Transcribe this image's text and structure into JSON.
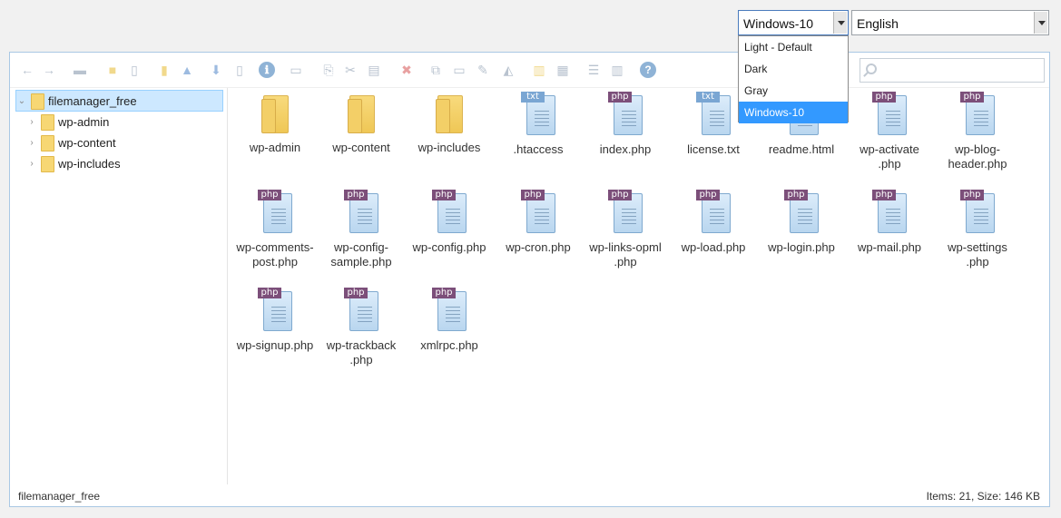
{
  "theme_select": {
    "value": "Windows-10",
    "options": [
      "Light - Default",
      "Dark",
      "Gray",
      "Windows-10"
    ],
    "selected_index": 3
  },
  "language_select": {
    "value": "English"
  },
  "toolbar": {
    "buttons": [
      {
        "name": "back-icon",
        "glyph": "←"
      },
      {
        "name": "forward-icon",
        "glyph": "→"
      },
      {
        "name": "up-icon",
        "glyph": "▬"
      },
      {
        "name": "home-icon",
        "glyph": "■"
      },
      {
        "name": "new-file-icon",
        "glyph": "▯"
      },
      {
        "name": "new-folder-icon",
        "glyph": "▮"
      },
      {
        "name": "upload-icon",
        "glyph": "▲"
      },
      {
        "name": "download-icon",
        "glyph": "⬇"
      },
      {
        "name": "view-icon",
        "glyph": "▯"
      },
      {
        "name": "info-icon",
        "glyph": "ℹ"
      },
      {
        "name": "preview-icon",
        "glyph": "▭"
      },
      {
        "name": "copy-icon",
        "glyph": "⎘"
      },
      {
        "name": "cut-icon",
        "glyph": "✂"
      },
      {
        "name": "paste-icon",
        "glyph": "▤"
      },
      {
        "name": "delete-icon",
        "glyph": "✖"
      },
      {
        "name": "duplicate-icon",
        "glyph": "⧉"
      },
      {
        "name": "rename-icon",
        "glyph": "▭"
      },
      {
        "name": "edit-icon",
        "glyph": "✎"
      },
      {
        "name": "resize-icon",
        "glyph": "◭"
      },
      {
        "name": "archive-icon",
        "glyph": "▥"
      },
      {
        "name": "extract-icon",
        "glyph": "▦"
      },
      {
        "name": "list-view-icon",
        "glyph": "☰"
      },
      {
        "name": "details-view-icon",
        "glyph": "▥"
      },
      {
        "name": "help-icon",
        "glyph": "?"
      }
    ],
    "search_placeholder": ""
  },
  "tree": {
    "root": "filemanager_free",
    "children": [
      "wp-admin",
      "wp-content",
      "wp-includes"
    ]
  },
  "files": [
    {
      "label": "wp-admin",
      "kind": "folder"
    },
    {
      "label": "wp-content",
      "kind": "folder"
    },
    {
      "label": "wp-includes",
      "kind": "folder"
    },
    {
      "label": ".htaccess",
      "kind": "doc",
      "tag": "txt"
    },
    {
      "label": "index.php",
      "kind": "doc",
      "tag": "php"
    },
    {
      "label": "license.txt",
      "kind": "doc",
      "tag": "txt"
    },
    {
      "label": "readme.html",
      "kind": "doc",
      "tag": "html"
    },
    {
      "label": "wp-activate .php",
      "kind": "doc",
      "tag": "php"
    },
    {
      "label": "wp-blog- header.php",
      "kind": "doc",
      "tag": "php"
    },
    {
      "label": "wp-comments- post.php",
      "kind": "doc",
      "tag": "php"
    },
    {
      "label": "wp-config- sample.php",
      "kind": "doc",
      "tag": "php"
    },
    {
      "label": "wp-config.php",
      "kind": "doc",
      "tag": "php"
    },
    {
      "label": "wp-cron.php",
      "kind": "doc",
      "tag": "php"
    },
    {
      "label": "wp-links-opml .php",
      "kind": "doc",
      "tag": "php"
    },
    {
      "label": "wp-load.php",
      "kind": "doc",
      "tag": "php"
    },
    {
      "label": "wp-login.php",
      "kind": "doc",
      "tag": "php"
    },
    {
      "label": "wp-mail.php",
      "kind": "doc",
      "tag": "php"
    },
    {
      "label": "wp-settings .php",
      "kind": "doc",
      "tag": "php"
    },
    {
      "label": "wp-signup.php",
      "kind": "doc",
      "tag": "php"
    },
    {
      "label": "wp-trackback .php",
      "kind": "doc",
      "tag": "php"
    },
    {
      "label": "xmlrpc.php",
      "kind": "doc",
      "tag": "php"
    }
  ],
  "status": {
    "path": "filemanager_free",
    "summary": "Items: 21, Size: 146 KB"
  }
}
